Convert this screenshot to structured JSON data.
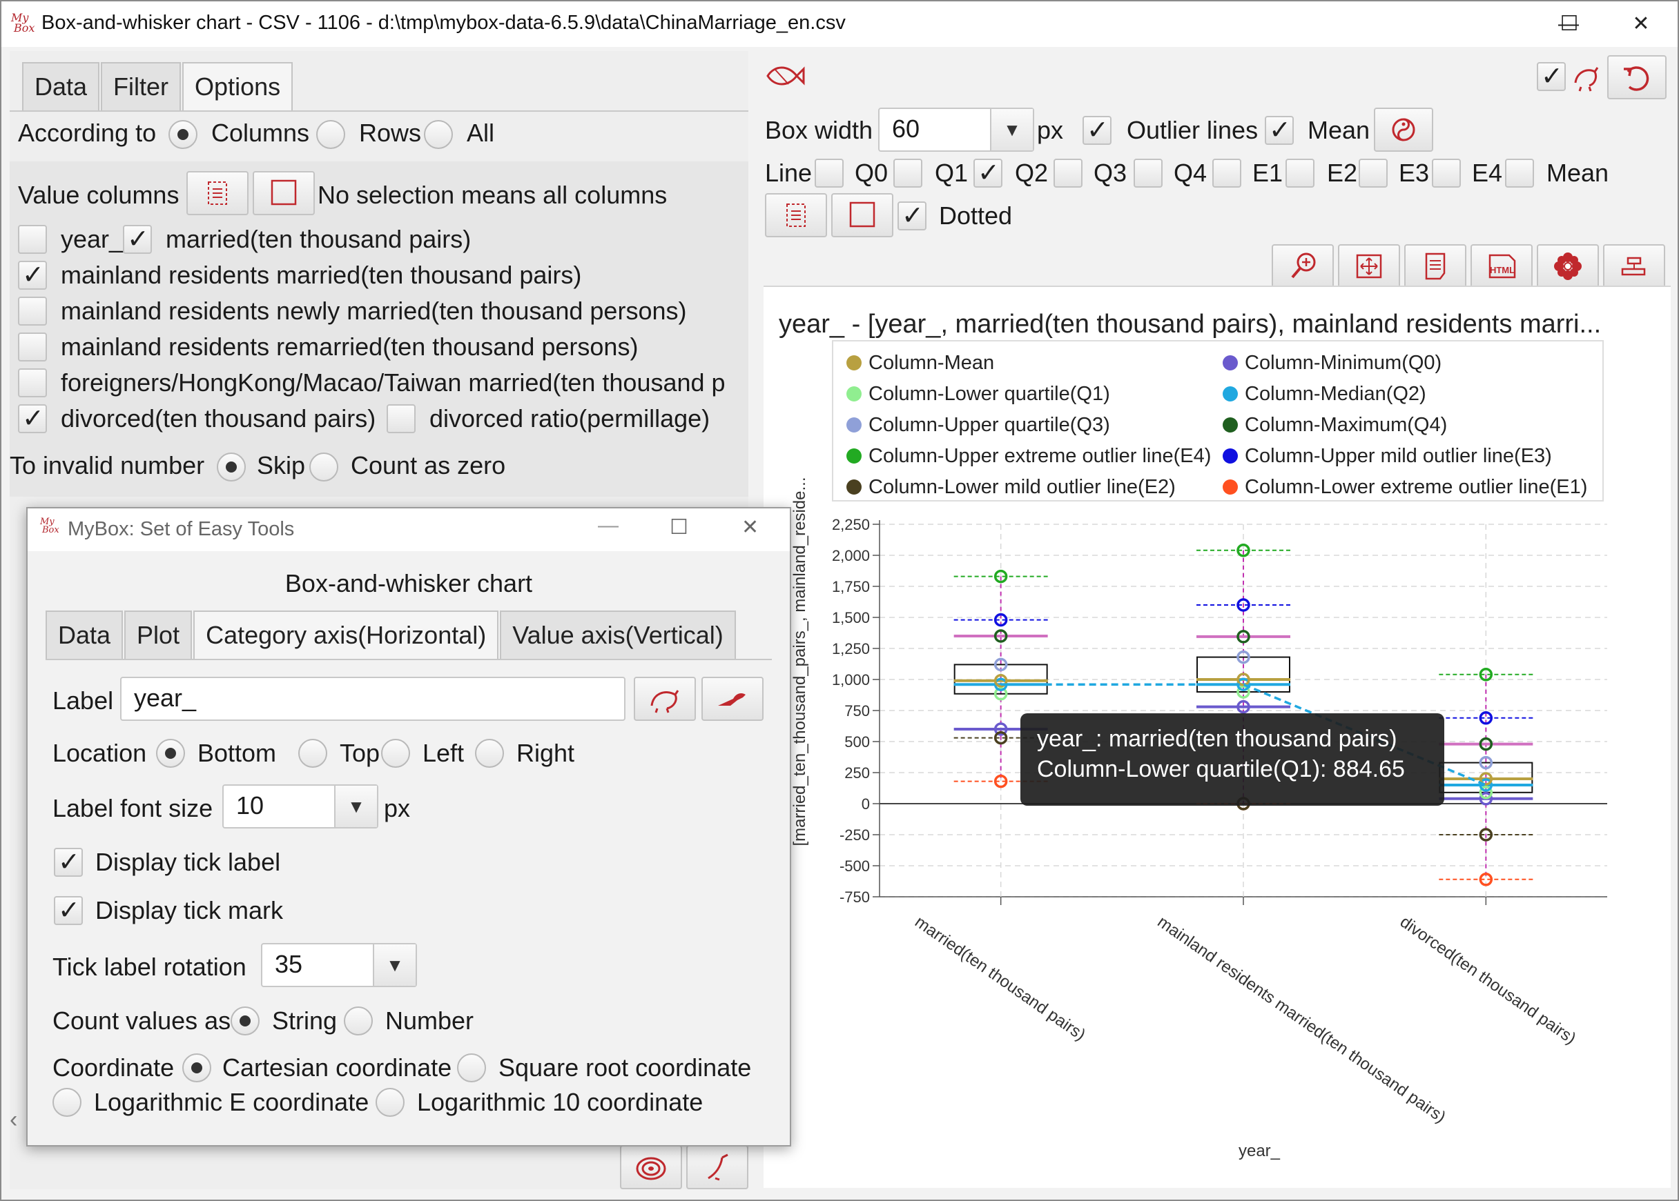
{
  "window": {
    "title": "Box-and-whisker chart - CSV - 1106 - d:\\tmp\\mybox-data-6.5.9\\data\\ChinaMarriage_en.csv",
    "logo_text_top": "My",
    "logo_text_bottom": "Box",
    "minimize": "—",
    "maximize": "☐",
    "close": "✕"
  },
  "left_panel": {
    "tabs": [
      "Data",
      "Filter",
      "Options"
    ],
    "according_to_label": "According to",
    "according_options": [
      "Columns",
      "Rows",
      "All"
    ],
    "according_selected": "Columns",
    "value_columns_label": "Value columns",
    "no_selection_hint": "No selection means all columns",
    "columns": [
      {
        "label": "year_",
        "checked": false
      },
      {
        "label": "married(ten thousand pairs)",
        "checked": true
      },
      {
        "label": "mainland residents married(ten thousand pairs)",
        "checked": true
      },
      {
        "label": "mainland residents newly married(ten thousand persons)",
        "checked": false
      },
      {
        "label": "mainland residents remarried(ten thousand persons)",
        "checked": false
      },
      {
        "label": "foreigners/HongKong/Macao/Taiwan married(ten thousand p",
        "checked": false
      },
      {
        "label": "divorced(ten thousand pairs)",
        "checked": true
      },
      {
        "label": "divorced ratio(permillage)",
        "checked": false
      }
    ],
    "invalid_label": "To invalid number",
    "invalid_options": [
      "Skip",
      "Count as zero"
    ],
    "invalid_selected": "Skip",
    "scroll_left": "‹"
  },
  "dialog": {
    "title": "MyBox: Set of Easy Tools",
    "heading": "Box-and-whisker chart",
    "tabs": [
      "Data",
      "Plot",
      "Category axis(Horizontal)",
      "Value axis(Vertical)"
    ],
    "label_label": "Label",
    "label_value": "year_",
    "location_label": "Location",
    "location_options": [
      "Bottom",
      "Top",
      "Left",
      "Right"
    ],
    "location_selected": "Bottom",
    "font_size_label": "Label font size",
    "font_size_value": "10",
    "px": "px",
    "display_tick_label": "Display tick label",
    "display_tick_mark": "Display tick mark",
    "rotation_label": "Tick label rotation",
    "rotation_value": "35",
    "count_label": "Count values as",
    "count_options": [
      "String",
      "Number"
    ],
    "count_selected": "String",
    "coordinate_label": "Coordinate",
    "coordinate_options": [
      "Cartesian coordinate",
      "Square root coordinate",
      "Logarithmic E coordinate",
      "Logarithmic 10 coordinate"
    ],
    "coordinate_selected": "Cartesian coordinate"
  },
  "right_panel": {
    "box_width_label": "Box width",
    "box_width_value": "60",
    "px": "px",
    "outlier_lines_label": "Outlier lines",
    "outlier_lines_checked": true,
    "mean_label": "Mean",
    "mean_checked": true,
    "line_label": "Line",
    "line_options": [
      "Q0",
      "Q1",
      "Q2",
      "Q3",
      "Q4",
      "E1",
      "E2",
      "E3",
      "E4",
      "Mean"
    ],
    "line_checked": [
      "Q1"
    ],
    "dotted_label": "Dotted",
    "dotted_checked": true
  },
  "tooltip": {
    "line1": "year_: married(ten thousand pairs)",
    "line2": "Column-Lower quartile(Q1): 884.65"
  },
  "colors": {
    "mean": "#b8a040",
    "q0": "#6a5acd",
    "q1": "#90ee90",
    "q2": "#20a8e0",
    "q3": "#8fa0d8",
    "q4": "#1f5f1f",
    "e4": "#22aa22",
    "e3": "#1010e0",
    "e2": "#4a4020",
    "e1": "#ff5020",
    "accent": "#c0282d"
  },
  "chart_data": {
    "type": "box",
    "title": "year_ - [year_, married(ten thousand pairs), mainland residents marri...",
    "xlabel": "year_",
    "ylabel": "[married_ten_thousand_pairs_, mainland_reside...",
    "yticks": [
      "2,250",
      "2,000",
      "1,750",
      "1,500",
      "1,250",
      "1,000",
      "750",
      "500",
      "250",
      "0",
      "-250",
      "-500",
      "-750"
    ],
    "ylim": [
      -750,
      2250
    ],
    "legend": [
      {
        "key": "mean",
        "label": "Column-Mean"
      },
      {
        "key": "q0",
        "label": "Column-Minimum(Q0)"
      },
      {
        "key": "q1",
        "label": "Column-Lower quartile(Q1)"
      },
      {
        "key": "q2",
        "label": "Column-Median(Q2)"
      },
      {
        "key": "q3",
        "label": "Column-Upper quartile(Q3)"
      },
      {
        "key": "q4",
        "label": "Column-Maximum(Q4)"
      },
      {
        "key": "e4",
        "label": "Column-Upper extreme outlier line(E4)"
      },
      {
        "key": "e3",
        "label": "Column-Upper mild outlier line(E3)"
      },
      {
        "key": "e2",
        "label": "Column-Lower mild outlier line(E2)"
      },
      {
        "key": "e1",
        "label": "Column-Lower extreme outlier line(E1)"
      }
    ],
    "categories": [
      "married(ten thousand pairs)",
      "mainland residents married(ten thousand pairs)",
      "divorced(ten thousand pairs)"
    ],
    "series": [
      {
        "key": "q0",
        "values": [
          600,
          780,
          40
        ]
      },
      {
        "key": "q1",
        "values": [
          884.65,
          900,
          90
        ]
      },
      {
        "key": "q2",
        "values": [
          960,
          960,
          150
        ]
      },
      {
        "key": "q3",
        "values": [
          1120,
          1180,
          330
        ]
      },
      {
        "key": "q4",
        "values": [
          1350,
          1345,
          480
        ]
      },
      {
        "key": "mean",
        "values": [
          990,
          1000,
          200
        ]
      },
      {
        "key": "e1",
        "values": [
          180,
          0,
          -610
        ]
      },
      {
        "key": "e2",
        "values": [
          530,
          0,
          -250
        ]
      },
      {
        "key": "e3",
        "values": [
          1480,
          1600,
          690
        ]
      },
      {
        "key": "e4",
        "values": [
          1830,
          2040,
          1040
        ]
      }
    ]
  }
}
